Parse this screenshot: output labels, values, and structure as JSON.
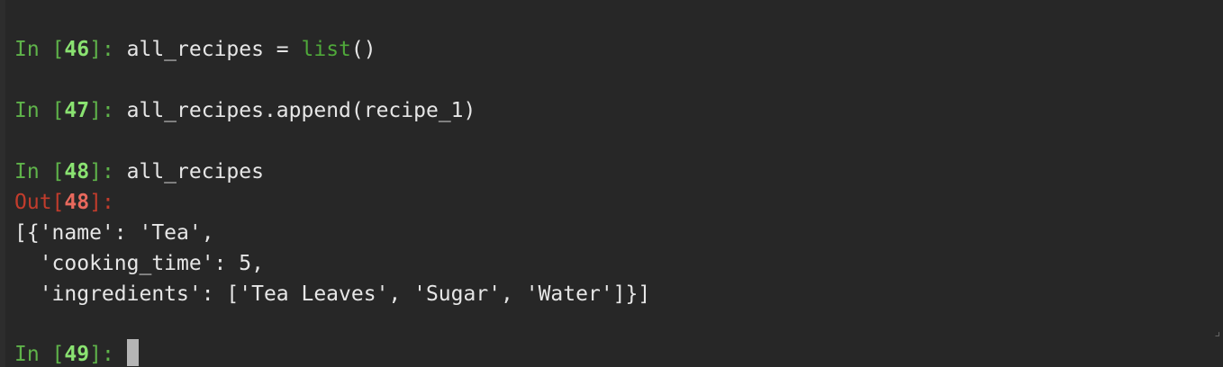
{
  "colors": {
    "background": "#272727",
    "prompt_in": "#5fb34a",
    "prompt_in_number": "#8ae271",
    "prompt_out": "#c23c2c",
    "prompt_out_number": "#e8695d",
    "code_text": "#e6e6e6",
    "builtin": "#4fa83a",
    "cursor": "#b5b5b5"
  },
  "cells": [
    {
      "in_prefix": "In [",
      "number": "46",
      "in_suffix": "]: ",
      "code_pre": "all_recipes = ",
      "builtin": "list",
      "code_post": "()"
    },
    {
      "in_prefix": "In [",
      "number": "47",
      "in_suffix": "]: ",
      "code": "all_recipes.append(recipe_1)"
    },
    {
      "in_prefix": "In [",
      "number": "48",
      "in_suffix": "]: ",
      "code": "all_recipes"
    }
  ],
  "output": {
    "out_prefix": "Out[",
    "number": "48",
    "out_suffix": "]:",
    "lines": [
      "[{'name': 'Tea',",
      "  'cooking_time': 5,",
      "  'ingredients': ['Tea Leaves', 'Sugar', 'Water']}]"
    ]
  },
  "current_prompt": {
    "in_prefix": "In [",
    "number": "49",
    "in_suffix": "]: "
  }
}
